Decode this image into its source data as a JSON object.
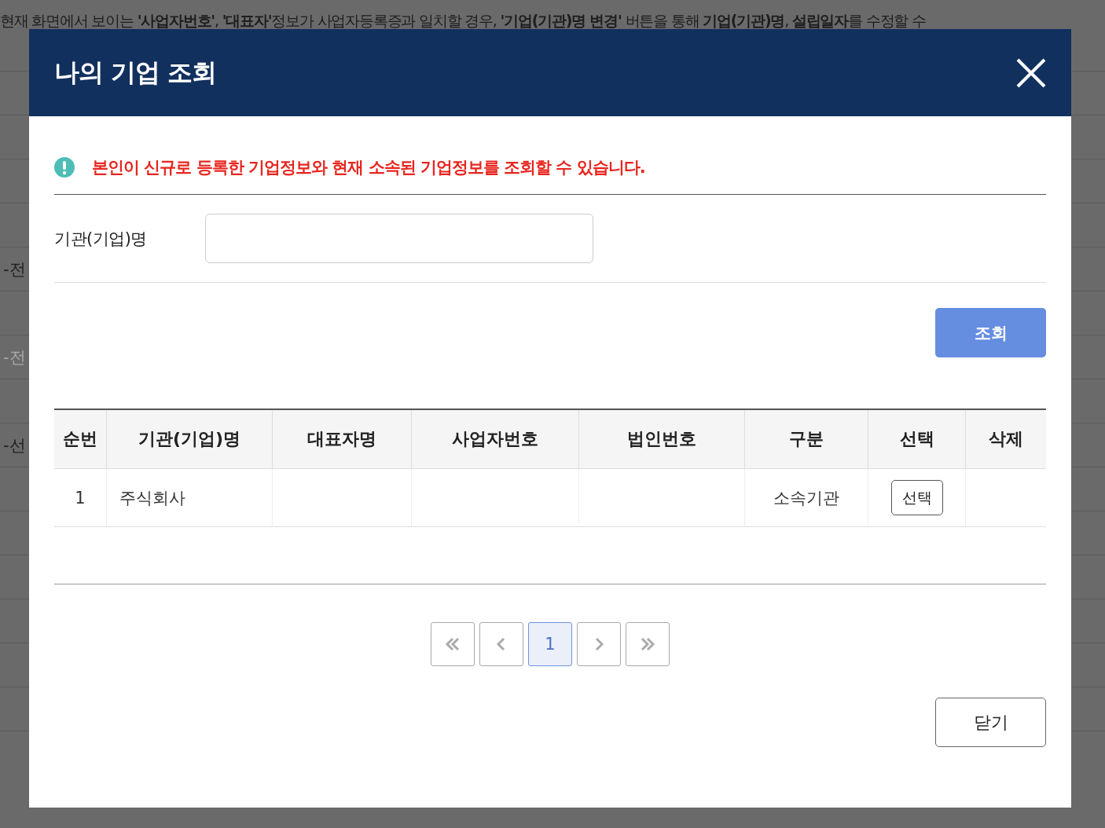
{
  "background": {
    "notice": "현재 화면에서 보이는 **'사업자번호'**, **'대표자'**정보가 사업자등록증과 일치할 경우, **'기업(기관)명 변경'** 버튼을 통해 **기업(기관)명**, **설립일자**를 수정할 수",
    "fragments": [
      {
        "text": "-전",
        "disabled": false
      },
      {
        "text": "-전",
        "disabled": true
      },
      {
        "text": "-선",
        "disabled": false
      }
    ]
  },
  "dialog": {
    "title": "나의 기업 조회",
    "notice": "본인이 신규로 등록한 기업정보와 현재 소속된 기업정보를 조회할 수 있습니다.",
    "field": {
      "label": "기관(기업)명"
    },
    "search_button": "조회",
    "table": {
      "columns": [
        "순번",
        "기관(기업)명",
        "대표자명",
        "사업자번호",
        "법인번호",
        "구분",
        "선택",
        "삭제"
      ],
      "rows": [
        {
          "no": "1",
          "name": "주식회사",
          "category": "소속기관",
          "select_button": "선택"
        }
      ]
    },
    "pagination": [
      {
        "kind": "first",
        "selected": false
      },
      {
        "kind": "prev",
        "selected": false
      },
      {
        "kind": "page",
        "label": "1",
        "selected": true
      },
      {
        "kind": "next",
        "selected": false
      },
      {
        "kind": "last",
        "selected": false
      }
    ],
    "close_button": "닫기"
  }
}
